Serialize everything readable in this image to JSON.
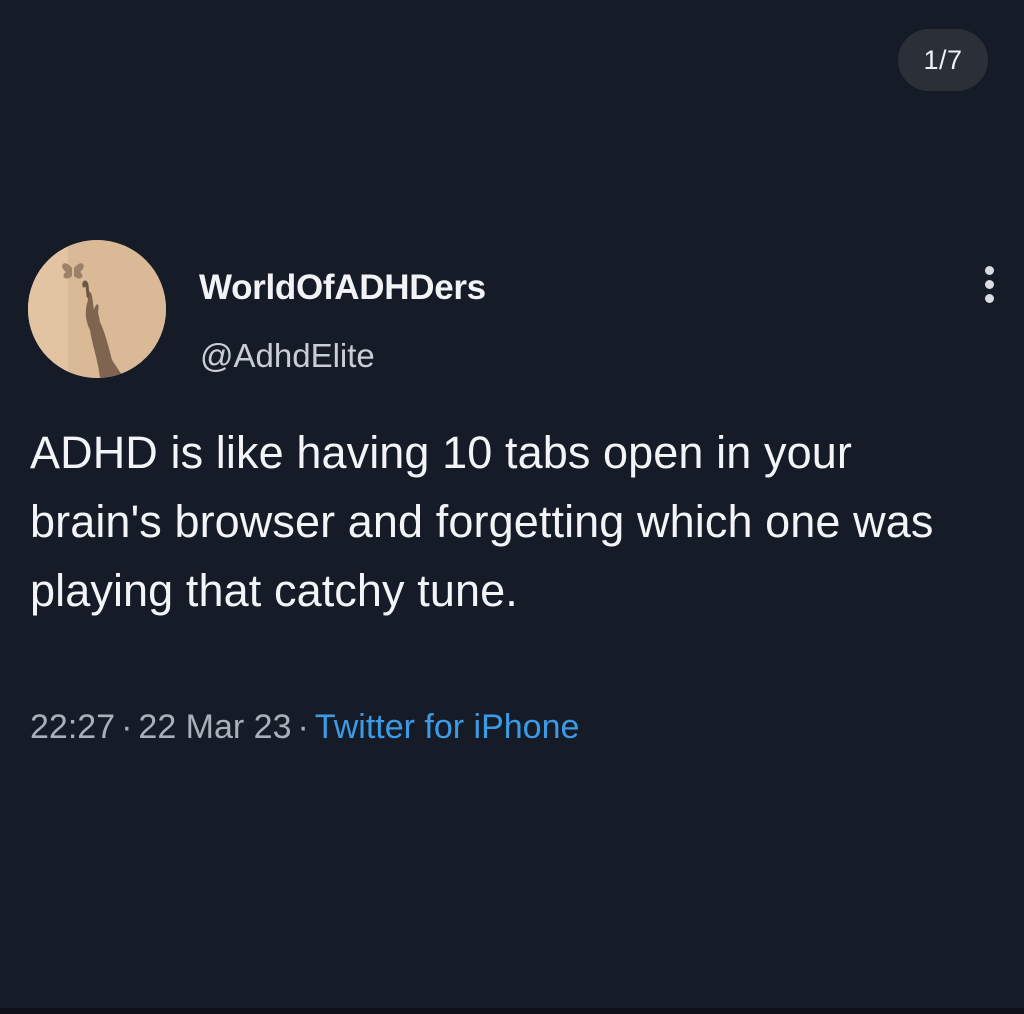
{
  "viewer": {
    "page_counter": "1/7"
  },
  "tweet": {
    "author": {
      "display_name": "WorldOfADHDers",
      "handle": "@AdhdElite"
    },
    "text": "ADHD is like having 10 tabs open in your brain's browser and forgetting which one was playing that catchy tune.",
    "meta": {
      "time": "22:27",
      "separator": "·",
      "date": "22 Mar 23",
      "source": "Twitter for iPhone"
    }
  },
  "icons": {
    "more": "more-vertical-icon",
    "avatar": "butterfly-hand-avatar"
  },
  "colors": {
    "background": "#161c27",
    "text": "#f2f4f7",
    "muted": "#a9b0ba",
    "link": "#3d9be6",
    "counter_bg": "#2a2f38"
  }
}
